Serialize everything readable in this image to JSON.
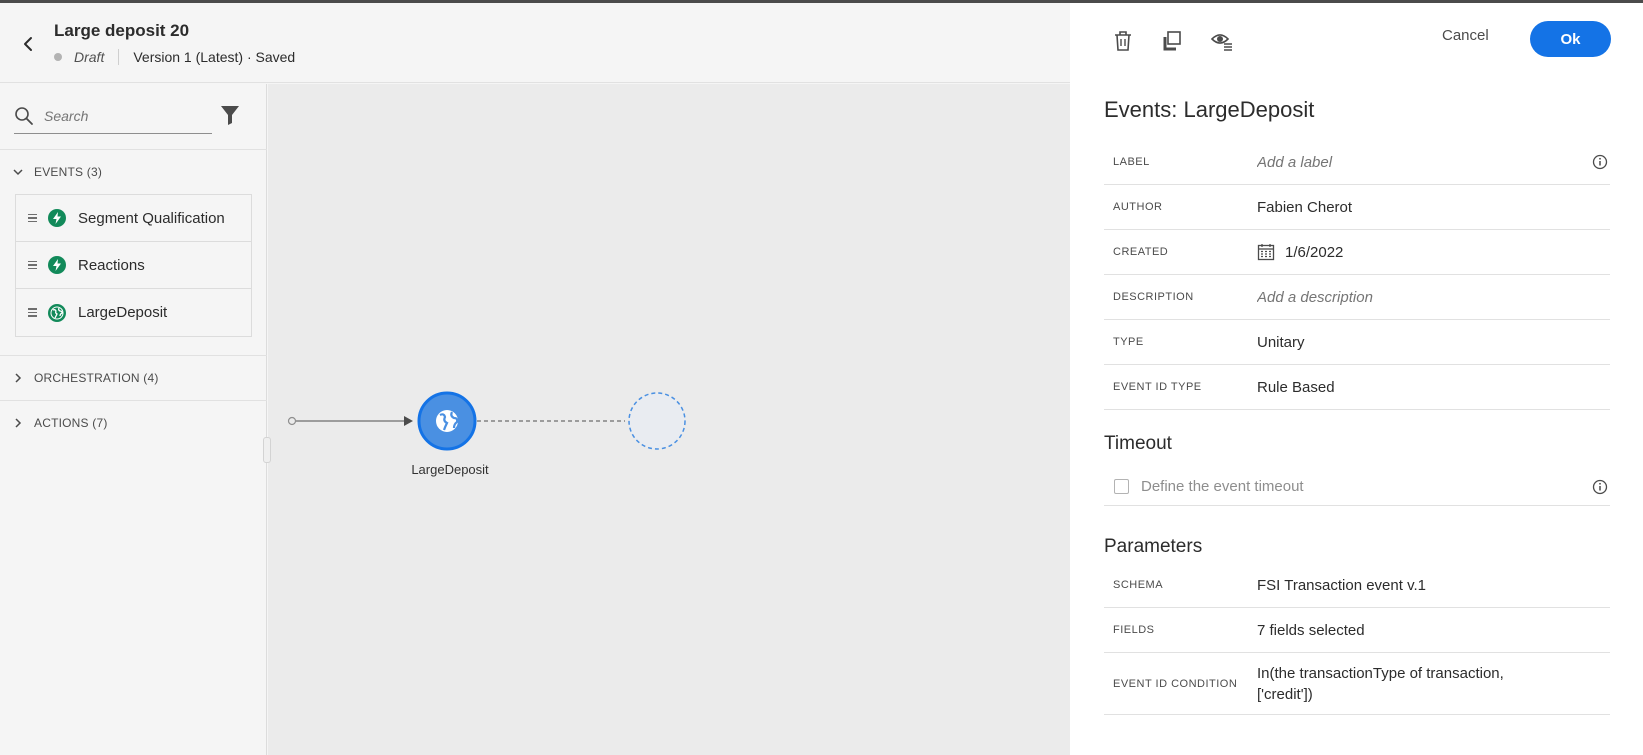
{
  "header": {
    "title": "Large deposit 20",
    "status": "Draft",
    "version": "Version 1 (Latest) · Saved"
  },
  "sidebar": {
    "search_placeholder": "Search",
    "sections": {
      "events": {
        "label": "EVENTS (3)",
        "items": [
          {
            "label": "Segment Qualification",
            "icon": "lightning-icon"
          },
          {
            "label": "Reactions",
            "icon": "lightning-icon"
          },
          {
            "label": "LargeDeposit",
            "icon": "globe-icon"
          }
        ]
      },
      "orchestration": {
        "label": "ORCHESTRATION (4)"
      },
      "actions": {
        "label": "ACTIONS (7)"
      }
    }
  },
  "canvas": {
    "node_label": "LargeDeposit"
  },
  "panel": {
    "cancel_label": "Cancel",
    "ok_label": "Ok",
    "title": "Events: LargeDeposit",
    "properties": {
      "label": {
        "key": "LABEL",
        "placeholder": "Add a label"
      },
      "author": {
        "key": "AUTHOR",
        "value": "Fabien Cherot"
      },
      "created": {
        "key": "CREATED",
        "value": "1/6/2022"
      },
      "description": {
        "key": "DESCRIPTION",
        "placeholder": "Add a description"
      },
      "type": {
        "key": "TYPE",
        "value": "Unitary"
      },
      "event_id_type": {
        "key": "EVENT ID TYPE",
        "value": "Rule Based"
      }
    },
    "timeout": {
      "title": "Timeout",
      "checkbox_label": "Define the event timeout"
    },
    "parameters": {
      "title": "Parameters",
      "schema": {
        "key": "SCHEMA",
        "value": "FSI Transaction event v.1"
      },
      "fields": {
        "key": "FIELDS",
        "value": "7 fields selected"
      },
      "condition": {
        "key": "EVENT ID CONDITION",
        "value_line1": "In(the transactionType of transaction,",
        "value_line2": "['credit'])"
      }
    }
  },
  "colors": {
    "accent": "#1473e6",
    "event_green": "#128a5a",
    "node_blue": "#4a90e2"
  }
}
